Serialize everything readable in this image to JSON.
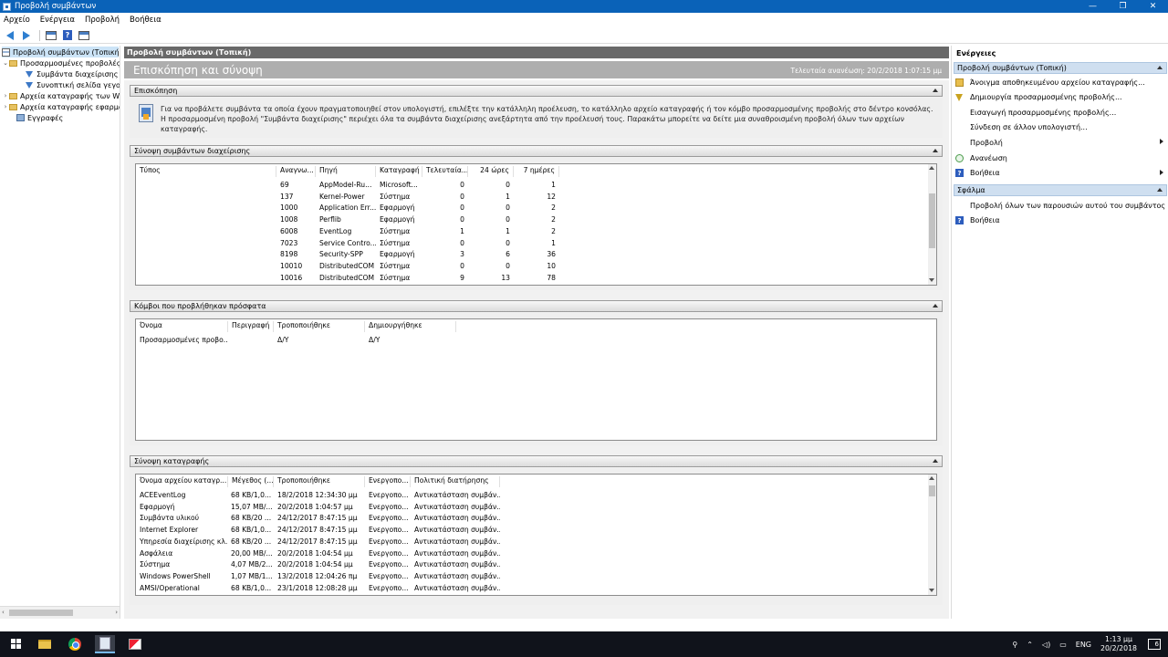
{
  "window": {
    "title": "Προβολή συμβάντων",
    "minimize": "—",
    "restore": "❐",
    "close": "✕"
  },
  "menu": [
    "Αρχείο",
    "Ενέργεια",
    "Προβολή",
    "Βοήθεια"
  ],
  "tree": {
    "items": [
      {
        "label": "Προβολή συμβάντων (Τοπική)",
        "level": 0,
        "icon": "event-viewer-icon",
        "expander": "",
        "selected": true
      },
      {
        "label": "Προσαρμοσμένες προβολές",
        "level": 0,
        "icon": "folder-icon",
        "expander": "⌄",
        "selected": false
      },
      {
        "label": "Συμβάντα διαχείρισης",
        "level": 1,
        "icon": "filter-icon",
        "expander": "",
        "selected": false
      },
      {
        "label": "Συνοπτική σελίδα γεγονότων",
        "level": 1,
        "icon": "filter-icon",
        "expander": "",
        "selected": false
      },
      {
        "label": "Αρχεία καταγραφής των Windows",
        "level": 0,
        "icon": "folder-icon",
        "expander": "›",
        "selected": false
      },
      {
        "label": "Αρχεία καταγραφής εφαρμογών και υπηρεσιών",
        "level": 0,
        "icon": "folder-icon",
        "expander": "›",
        "selected": false
      },
      {
        "label": "Εγγραφές",
        "level": 0,
        "icon": "subscriptions-icon",
        "expander": "",
        "selected": false
      }
    ]
  },
  "center": {
    "header": "Προβολή συμβάντων (Τοπική)",
    "overview_title": "Επισκόπηση και σύνοψη",
    "last_refresh": "Τελευταία ανανέωση: 20/2/2018 1:07:15 μμ",
    "overview": {
      "title": "Επισκόπηση",
      "text": "Για να προβάλετε συμβάντα τα οποία έχουν πραγματοποιηθεί στον υπολογιστή, επιλέξτε την κατάλληλη προέλευση, το κατάλληλο αρχείο καταγραφής ή τον κόμβο προσαρμοσμένης προβολής στο δέντρο κονσόλας. Η προσαρμοσμένη προβολή \"Συμβάντα διαχείρισης\" περιέχει όλα τα συμβάντα διαχείρισης ανεξάρτητα από την προέλευσή τους. Παρακάτω μπορείτε να δείτε μια συναθροισμένη προβολή όλων των αρχείων καταγραφής."
    },
    "admin_summary": {
      "title": "Σύνοψη συμβάντων διαχείρισης",
      "columns": [
        "Τύπος",
        "Αναγνω...",
        "Πηγή",
        "Καταγραφή",
        "Τελευταία...",
        "24 ώρες",
        "7 ημέρες"
      ],
      "rows": [
        [
          "",
          "69",
          "AppModel-Ru...",
          "Microsoft...",
          "0",
          "0",
          "1"
        ],
        [
          "",
          "137",
          "Kernel-Power",
          "Σύστημα",
          "0",
          "1",
          "12"
        ],
        [
          "",
          "1000",
          "Application Err...",
          "Εφαρμογή",
          "0",
          "0",
          "2"
        ],
        [
          "",
          "1008",
          "Perflib",
          "Εφαρμογή",
          "0",
          "0",
          "2"
        ],
        [
          "",
          "6008",
          "EventLog",
          "Σύστημα",
          "1",
          "1",
          "2"
        ],
        [
          "",
          "7023",
          "Service Contro...",
          "Σύστημα",
          "0",
          "0",
          "1"
        ],
        [
          "",
          "8198",
          "Security-SPP",
          "Εφαρμογή",
          "3",
          "6",
          "36"
        ],
        [
          "",
          "10010",
          "DistributedCOM",
          "Σύστημα",
          "0",
          "0",
          "10"
        ],
        [
          "",
          "10016",
          "DistributedCOM",
          "Σύστημα",
          "9",
          "13",
          "78"
        ]
      ]
    },
    "recent_nodes": {
      "title": "Κόμβοι που προβλήθηκαν πρόσφατα",
      "columns": [
        "Όνομα",
        "Περιγραφή",
        "Τροποποιήθηκε",
        "Δημιουργήθηκε"
      ],
      "rows": [
        [
          "Προσαρμοσμένες προβο...",
          "",
          "Δ/Υ",
          "Δ/Υ"
        ]
      ]
    },
    "log_summary": {
      "title": "Σύνοψη καταγραφής",
      "columns": [
        "Όνομα αρχείου καταγρ...",
        "Μέγεθος (...",
        "Τροποποιήθηκε",
        "Ενεργοπο...",
        "Πολιτική διατήρησης"
      ],
      "rows": [
        [
          "ACEEventLog",
          "68 KB/1,0...",
          "18/2/2018 12:34:30 μμ",
          "Ενεργοπο...",
          "Αντικατάσταση συμβάν..."
        ],
        [
          "Εφαρμογή",
          "15,07 MB/...",
          "20/2/2018 1:04:57 μμ",
          "Ενεργοπο...",
          "Αντικατάσταση συμβάν..."
        ],
        [
          "Συμβάντα υλικού",
          "68 KB/20 ...",
          "24/12/2017 8:47:15 μμ",
          "Ενεργοπο...",
          "Αντικατάσταση συμβάν..."
        ],
        [
          "Internet Explorer",
          "68 KB/1,0...",
          "24/12/2017 8:47:15 μμ",
          "Ενεργοπο...",
          "Αντικατάσταση συμβάν..."
        ],
        [
          "Υπηρεσία διαχείρισης κλ...",
          "68 KB/20 ...",
          "24/12/2017 8:47:15 μμ",
          "Ενεργοπο...",
          "Αντικατάσταση συμβάν..."
        ],
        [
          "Ασφάλεια",
          "20,00 MB/...",
          "20/2/2018 1:04:54 μμ",
          "Ενεργοπο...",
          "Αντικατάσταση συμβάν..."
        ],
        [
          "Σύστημα",
          "4,07 MB/2...",
          "20/2/2018 1:04:54 μμ",
          "Ενεργοπο...",
          "Αντικατάσταση συμβάν..."
        ],
        [
          "Windows PowerShell",
          "1,07 MB/1...",
          "13/2/2018 12:04:26 πμ",
          "Ενεργοπο...",
          "Αντικατάσταση συμβάν..."
        ],
        [
          "AMSI/Operational",
          "68 KB/1,0...",
          "23/1/2018 12:08:28 μμ",
          "Ενεργοπο...",
          "Αντικατάσταση συμβάν..."
        ]
      ]
    }
  },
  "actions": {
    "title": "Ενέργειες",
    "section1": "Προβολή συμβάντων (Τοπική)",
    "items1": [
      {
        "label": "Άνοιγμα αποθηκευμένου αρχείου καταγραφής...",
        "icon": "open-log-icon",
        "submenu": false
      },
      {
        "label": "Δημιουργία προσαρμοσμένης προβολής...",
        "icon": "filter-icon",
        "submenu": false
      },
      {
        "label": "Εισαγωγή προσαρμοσμένης προβολής...",
        "icon": "",
        "submenu": false
      },
      {
        "label": "Σύνδεση σε άλλον υπολογιστή...",
        "icon": "",
        "submenu": false
      },
      {
        "label": "Προβολή",
        "icon": "",
        "submenu": true
      },
      {
        "label": "Ανανέωση",
        "icon": "refresh-icon",
        "submenu": false
      },
      {
        "label": "Βοήθεια",
        "icon": "help-icon",
        "submenu": true
      }
    ],
    "section2": "Σφάλμα",
    "items2": [
      {
        "label": "Προβολή όλων των παρουσιών αυτού του συμβάντος",
        "icon": "",
        "submenu": false
      },
      {
        "label": "Βοήθεια",
        "icon": "help-icon",
        "submenu": false
      }
    ]
  },
  "taskbar": {
    "lang": "ENG",
    "time": "1:13 μμ",
    "date": "20/2/2018",
    "notifications": "6"
  }
}
